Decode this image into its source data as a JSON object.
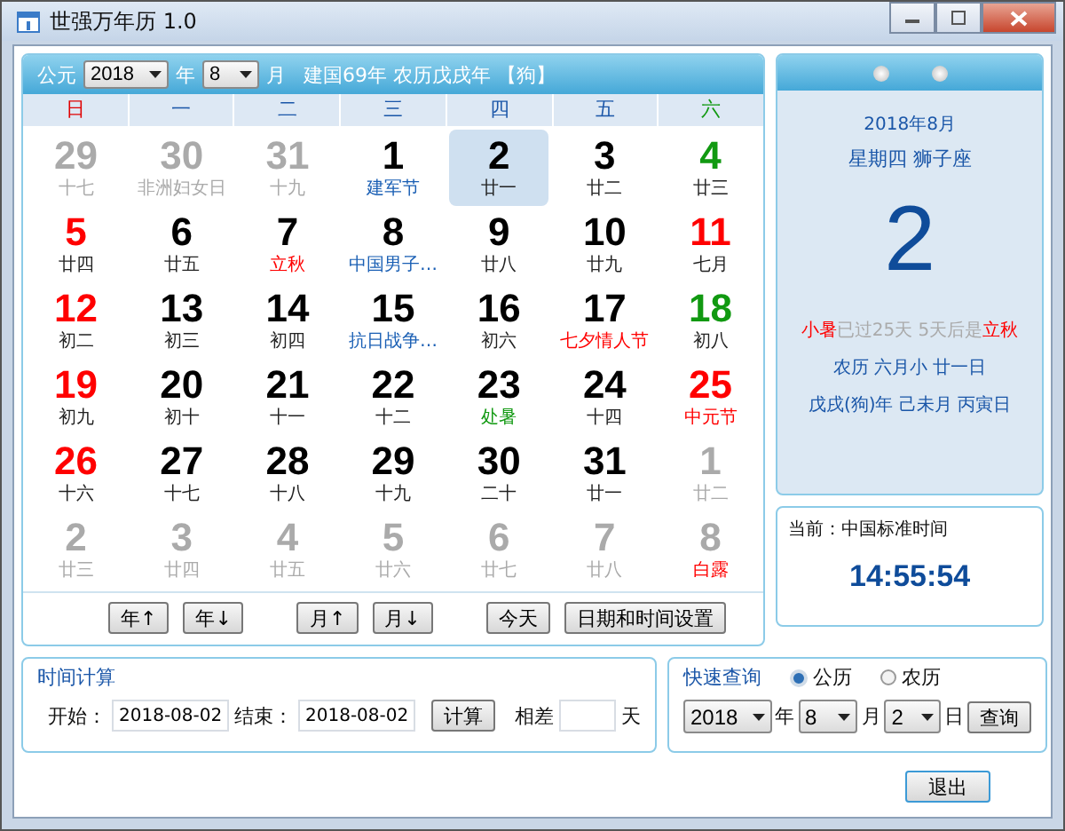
{
  "window": {
    "title": "世强万年历 1.0"
  },
  "header": {
    "era_label": "公元",
    "year": "2018",
    "year_label": "年",
    "month": "8",
    "month_label": "月",
    "info": "建国69年  农历戊戌年 【狗】"
  },
  "weekdays": [
    {
      "label": "日",
      "color": "#e00000"
    },
    {
      "label": "一",
      "color": "#1a56a8"
    },
    {
      "label": "二",
      "color": "#1a56a8"
    },
    {
      "label": "三",
      "color": "#1a56a8"
    },
    {
      "label": "四",
      "color": "#1a56a8"
    },
    {
      "label": "五",
      "color": "#1a56a8"
    },
    {
      "label": "六",
      "color": "#119911"
    }
  ],
  "days": [
    {
      "day": {
        "text": "29",
        "color": "#aaaaaa"
      },
      "lunar": {
        "text": "十七",
        "color": "#aaaaaa"
      },
      "selected": false
    },
    {
      "day": {
        "text": "30",
        "color": "#aaaaaa"
      },
      "lunar": {
        "text": "非洲妇女日",
        "color": "#aaaaaa"
      },
      "selected": false
    },
    {
      "day": {
        "text": "31",
        "color": "#aaaaaa"
      },
      "lunar": {
        "text": "十九",
        "color": "#aaaaaa"
      },
      "selected": false
    },
    {
      "day": {
        "text": "1",
        "color": "#000000"
      },
      "lunar": {
        "text": "建军节",
        "color": "#1a5fb4"
      },
      "selected": false
    },
    {
      "day": {
        "text": "2",
        "color": "#000000"
      },
      "lunar": {
        "text": "廿一",
        "color": "#222222"
      },
      "selected": true
    },
    {
      "day": {
        "text": "3",
        "color": "#000000"
      },
      "lunar": {
        "text": "廿二",
        "color": "#222222"
      },
      "selected": false
    },
    {
      "day": {
        "text": "4",
        "color": "#119911"
      },
      "lunar": {
        "text": "廿三",
        "color": "#222222"
      },
      "selected": false
    },
    {
      "day": {
        "text": "5",
        "color": "#ff0000"
      },
      "lunar": {
        "text": "廿四",
        "color": "#222222"
      },
      "selected": false
    },
    {
      "day": {
        "text": "6",
        "color": "#000000"
      },
      "lunar": {
        "text": "廿五",
        "color": "#222222"
      },
      "selected": false
    },
    {
      "day": {
        "text": "7",
        "color": "#000000"
      },
      "lunar": {
        "text": "立秋",
        "color": "#ff0000"
      },
      "selected": false
    },
    {
      "day": {
        "text": "8",
        "color": "#000000"
      },
      "lunar": {
        "text": "中国男子…",
        "color": "#1a5fb4"
      },
      "selected": false
    },
    {
      "day": {
        "text": "9",
        "color": "#000000"
      },
      "lunar": {
        "text": "廿八",
        "color": "#222222"
      },
      "selected": false
    },
    {
      "day": {
        "text": "10",
        "color": "#000000"
      },
      "lunar": {
        "text": "廿九",
        "color": "#222222"
      },
      "selected": false
    },
    {
      "day": {
        "text": "11",
        "color": "#ff0000"
      },
      "lunar": {
        "text": "七月",
        "color": "#222222"
      },
      "selected": false
    },
    {
      "day": {
        "text": "12",
        "color": "#ff0000"
      },
      "lunar": {
        "text": "初二",
        "color": "#222222"
      },
      "selected": false
    },
    {
      "day": {
        "text": "13",
        "color": "#000000"
      },
      "lunar": {
        "text": "初三",
        "color": "#222222"
      },
      "selected": false
    },
    {
      "day": {
        "text": "14",
        "color": "#000000"
      },
      "lunar": {
        "text": "初四",
        "color": "#222222"
      },
      "selected": false
    },
    {
      "day": {
        "text": "15",
        "color": "#000000"
      },
      "lunar": {
        "text": "抗日战争…",
        "color": "#1a5fb4"
      },
      "selected": false
    },
    {
      "day": {
        "text": "16",
        "color": "#000000"
      },
      "lunar": {
        "text": "初六",
        "color": "#222222"
      },
      "selected": false
    },
    {
      "day": {
        "text": "17",
        "color": "#000000"
      },
      "lunar": {
        "text": "七夕情人节",
        "color": "#ff0000"
      },
      "selected": false
    },
    {
      "day": {
        "text": "18",
        "color": "#119911"
      },
      "lunar": {
        "text": "初八",
        "color": "#222222"
      },
      "selected": false
    },
    {
      "day": {
        "text": "19",
        "color": "#ff0000"
      },
      "lunar": {
        "text": "初九",
        "color": "#222222"
      },
      "selected": false
    },
    {
      "day": {
        "text": "20",
        "color": "#000000"
      },
      "lunar": {
        "text": "初十",
        "color": "#222222"
      },
      "selected": false
    },
    {
      "day": {
        "text": "21",
        "color": "#000000"
      },
      "lunar": {
        "text": "十一",
        "color": "#222222"
      },
      "selected": false
    },
    {
      "day": {
        "text": "22",
        "color": "#000000"
      },
      "lunar": {
        "text": "十二",
        "color": "#222222"
      },
      "selected": false
    },
    {
      "day": {
        "text": "23",
        "color": "#000000"
      },
      "lunar": {
        "text": "处暑",
        "color": "#119911"
      },
      "selected": false
    },
    {
      "day": {
        "text": "24",
        "color": "#000000"
      },
      "lunar": {
        "text": "十四",
        "color": "#222222"
      },
      "selected": false
    },
    {
      "day": {
        "text": "25",
        "color": "#ff0000"
      },
      "lunar": {
        "text": "中元节",
        "color": "#ff0000"
      },
      "selected": false
    },
    {
      "day": {
        "text": "26",
        "color": "#ff0000"
      },
      "lunar": {
        "text": "十六",
        "color": "#222222"
      },
      "selected": false
    },
    {
      "day": {
        "text": "27",
        "color": "#000000"
      },
      "lunar": {
        "text": "十七",
        "color": "#222222"
      },
      "selected": false
    },
    {
      "day": {
        "text": "28",
        "color": "#000000"
      },
      "lunar": {
        "text": "十八",
        "color": "#222222"
      },
      "selected": false
    },
    {
      "day": {
        "text": "29",
        "color": "#000000"
      },
      "lunar": {
        "text": "十九",
        "color": "#222222"
      },
      "selected": false
    },
    {
      "day": {
        "text": "30",
        "color": "#000000"
      },
      "lunar": {
        "text": "二十",
        "color": "#222222"
      },
      "selected": false
    },
    {
      "day": {
        "text": "31",
        "color": "#000000"
      },
      "lunar": {
        "text": "廿一",
        "color": "#222222"
      },
      "selected": false
    },
    {
      "day": {
        "text": "1",
        "color": "#aaaaaa"
      },
      "lunar": {
        "text": "廿二",
        "color": "#aaaaaa"
      },
      "selected": false
    },
    {
      "day": {
        "text": "2",
        "color": "#aaaaaa"
      },
      "lunar": {
        "text": "廿三",
        "color": "#aaaaaa"
      },
      "selected": false
    },
    {
      "day": {
        "text": "3",
        "color": "#aaaaaa"
      },
      "lunar": {
        "text": "廿四",
        "color": "#aaaaaa"
      },
      "selected": false
    },
    {
      "day": {
        "text": "4",
        "color": "#aaaaaa"
      },
      "lunar": {
        "text": "廿五",
        "color": "#aaaaaa"
      },
      "selected": false
    },
    {
      "day": {
        "text": "5",
        "color": "#aaaaaa"
      },
      "lunar": {
        "text": "廿六",
        "color": "#aaaaaa"
      },
      "selected": false
    },
    {
      "day": {
        "text": "6",
        "color": "#aaaaaa"
      },
      "lunar": {
        "text": "廿七",
        "color": "#aaaaaa"
      },
      "selected": false
    },
    {
      "day": {
        "text": "7",
        "color": "#aaaaaa"
      },
      "lunar": {
        "text": "廿八",
        "color": "#aaaaaa"
      },
      "selected": false
    },
    {
      "day": {
        "text": "8",
        "color": "#aaaaaa"
      },
      "lunar": {
        "text": "白露",
        "color": "#ff0000"
      },
      "selected": false
    }
  ],
  "nav_buttons": [
    "年↑",
    "年↓",
    "月↑",
    "月↓",
    "今天",
    "日期和时间设置"
  ],
  "day_card": {
    "month": "2018年8月",
    "weekday": "星期四  狮子座",
    "day": "2",
    "term": [
      {
        "text": "小暑",
        "color": "#ff0000"
      },
      {
        "text": "已过25天  5天后是",
        "color": "#aaaaaa"
      },
      {
        "text": "立秋",
        "color": "#ff0000"
      }
    ],
    "lunar": "农历   六月小  廿一日",
    "ganzhi": "戊戌(狗)年  己未月  丙寅日"
  },
  "clock": {
    "label": "当前：中国标准时间",
    "time": "14:55:54"
  },
  "time_calc": {
    "title": "时间计算",
    "start_label": "开始：",
    "start": "2018-08-02",
    "end_label": "结束：",
    "end": "2018-08-02",
    "button": "计算",
    "diff_label": "相差",
    "unit": "天"
  },
  "quick_query": {
    "title": "快速查询",
    "calendars": [
      {
        "label": "公历",
        "selected": true
      },
      {
        "label": "农历",
        "selected": false
      }
    ],
    "year": "2018",
    "year_label": "年",
    "month": "8",
    "month_label": "月",
    "day": "2",
    "day_label": "日",
    "button": "查询"
  },
  "exit_button": "退出"
}
